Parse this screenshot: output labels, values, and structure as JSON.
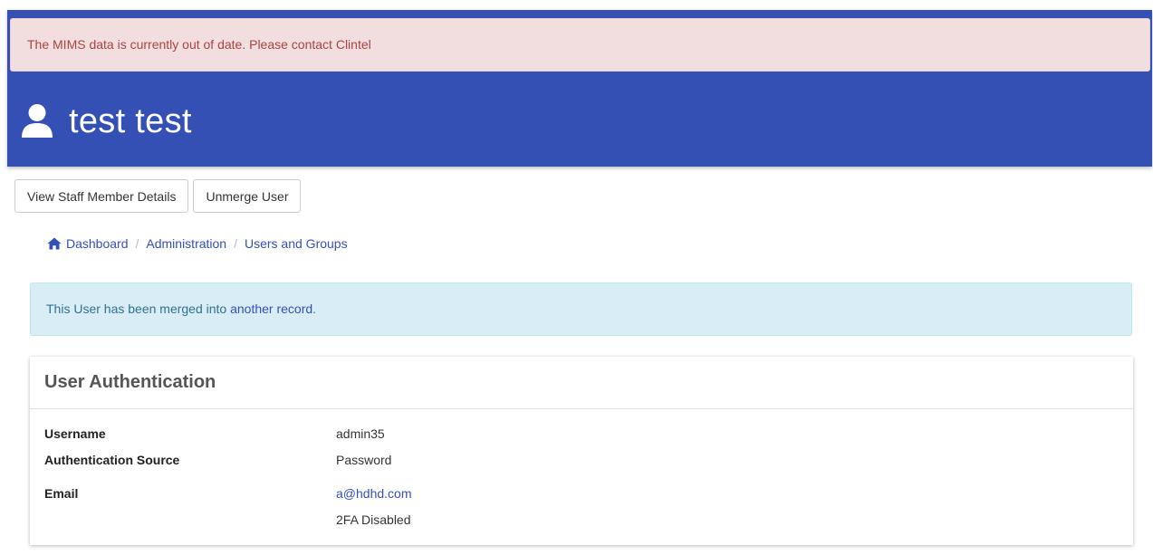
{
  "alert": {
    "message": "The MIMS data is currently out of date. Please contact Clintel"
  },
  "header": {
    "title": "test test",
    "icon": "user-icon",
    "background_color": "#3550b5"
  },
  "actions": {
    "view_staff_label": "View Staff Member Details",
    "unmerge_label": "Unmerge User"
  },
  "breadcrumb": {
    "items": [
      {
        "label": "Dashboard",
        "icon": "home-icon"
      },
      {
        "label": "Administration"
      },
      {
        "label": "Users and Groups"
      }
    ]
  },
  "merge_notice": {
    "text": "This User has been merged into",
    "link": "another record",
    "suffix": "."
  },
  "panel": {
    "title": "User Authentication",
    "fields": {
      "username": {
        "label": "Username",
        "value": "admin35"
      },
      "auth_source": {
        "label": "Authentication Source",
        "value": "Password"
      },
      "email": {
        "label": "Email",
        "value": "a@hdhd.com",
        "note": "2FA Disabled"
      }
    }
  },
  "colors": {
    "link": "#3550b5",
    "danger_bg": "#f2dede",
    "danger_text": "#a94442",
    "info_bg": "#d9edf7",
    "info_text": "#31708f"
  }
}
